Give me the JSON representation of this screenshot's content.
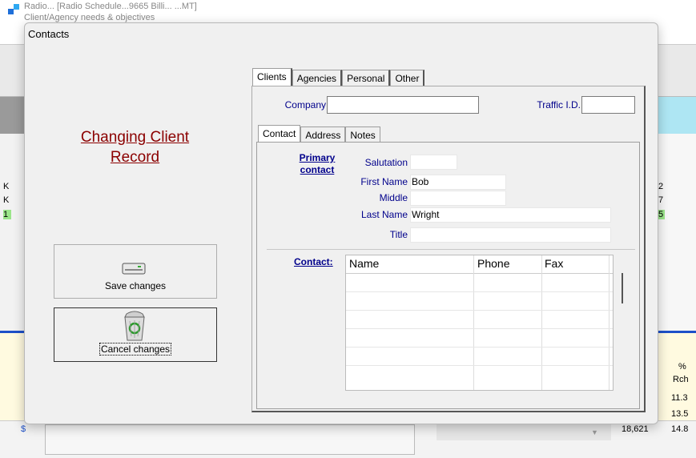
{
  "background": {
    "ghost_title": "Radio... [Radio Schedule...9665 Billi... ...MT]",
    "ghost_subtitle": "Client/Agency needs & objectives",
    "left_cells": [
      "K",
      "K",
      "1"
    ],
    "right_cells": [
      "2",
      "7",
      "5"
    ],
    "right_header_pct": "%",
    "right_header_rch": "Rch",
    "right_values": [
      "11.3",
      "13.5",
      "14.8"
    ],
    "bottom_value": "18,621",
    "dollar": "$"
  },
  "dialog": {
    "title": "Contacts",
    "heading": "Changing Client Record",
    "save_label": "Save changes",
    "cancel_label": "Cancel changes"
  },
  "outer_tabs": [
    "Clients",
    "Agencies",
    "Personal",
    "Other"
  ],
  "client": {
    "company_label": "Company",
    "company_value": "",
    "traffic_label": "Traffic I.D.",
    "traffic_value": ""
  },
  "inner_tabs": [
    "Contact",
    "Address",
    "Notes"
  ],
  "contact": {
    "primary_link": "Primary contact",
    "salutation_label": "Salutation",
    "salutation_value": "",
    "first_label": "First Name",
    "first_value": "Bob",
    "middle_label": "Middle",
    "middle_value": "",
    "last_label": "Last Name",
    "last_value": "Wright",
    "title_label": "Title",
    "title_value": ""
  },
  "contacts_grid": {
    "link": "Contact:",
    "columns": [
      "Name",
      "Phone",
      "Fax"
    ]
  }
}
